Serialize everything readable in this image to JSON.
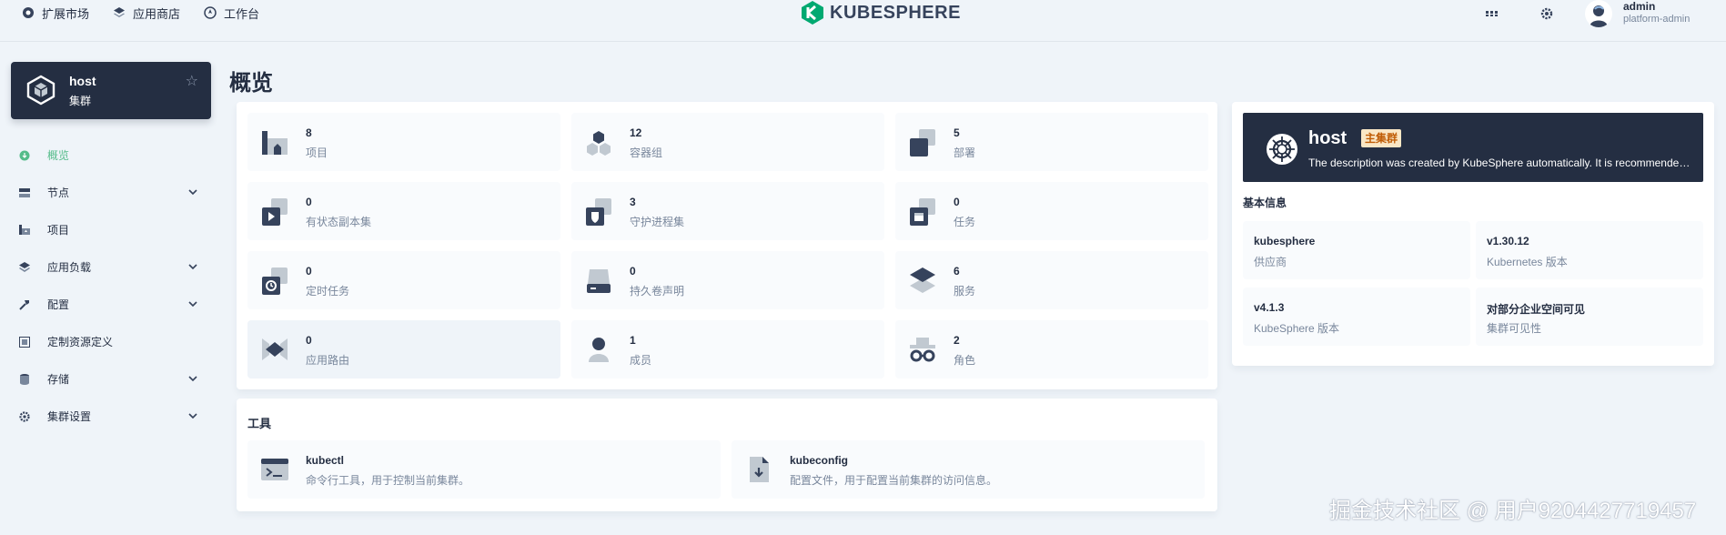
{
  "topnav": {
    "items": [
      {
        "label": "扩展市场",
        "icon": "extensions-icon"
      },
      {
        "label": "应用商店",
        "icon": "appstore-icon"
      },
      {
        "label": "工作台",
        "icon": "workbench-icon"
      }
    ]
  },
  "logo": {
    "text": "KUBESPHERE",
    "color": "#00a971"
  },
  "user": {
    "name": "admin",
    "role": "platform-admin"
  },
  "cluster": {
    "name": "host",
    "type": "集群"
  },
  "sidebar": {
    "items": [
      {
        "label": "概览",
        "icon": "overview-icon",
        "active": true
      },
      {
        "label": "节点",
        "icon": "nodes-icon",
        "expandable": true
      },
      {
        "label": "项目",
        "icon": "projects-icon"
      },
      {
        "label": "应用负载",
        "icon": "workloads-icon",
        "expandable": true
      },
      {
        "label": "配置",
        "icon": "config-icon",
        "expandable": true
      },
      {
        "label": "定制资源定义",
        "icon": "crd-icon"
      },
      {
        "label": "存储",
        "icon": "storage-icon",
        "expandable": true
      },
      {
        "label": "集群设置",
        "icon": "cluster-settings-icon",
        "expandable": true
      }
    ]
  },
  "page": {
    "title": "概览"
  },
  "resources": [
    {
      "count": "8",
      "label": "项目",
      "icon": "project-icon"
    },
    {
      "count": "12",
      "label": "容器组",
      "icon": "pod-icon"
    },
    {
      "count": "5",
      "label": "部署",
      "icon": "deployment-icon"
    },
    {
      "count": "0",
      "label": "有状态副本集",
      "icon": "statefulset-icon"
    },
    {
      "count": "3",
      "label": "守护进程集",
      "icon": "daemonset-icon"
    },
    {
      "count": "0",
      "label": "任务",
      "icon": "job-icon"
    },
    {
      "count": "0",
      "label": "定时任务",
      "icon": "cronjob-icon"
    },
    {
      "count": "0",
      "label": "持久卷声明",
      "icon": "pvc-icon"
    },
    {
      "count": "6",
      "label": "服务",
      "icon": "service-icon"
    },
    {
      "count": "0",
      "label": "应用路由",
      "icon": "ingress-icon",
      "highlighted": true
    },
    {
      "count": "1",
      "label": "成员",
      "icon": "member-icon"
    },
    {
      "count": "2",
      "label": "角色",
      "icon": "role-icon"
    }
  ],
  "tools": {
    "title": "工具",
    "items": [
      {
        "name": "kubectl",
        "desc": "命令行工具，用于控制当前集群。",
        "icon": "terminal-icon"
      },
      {
        "name": "kubeconfig",
        "desc": "配置文件，用于配置当前集群的访问信息。",
        "icon": "kubeconfig-file-icon"
      }
    ]
  },
  "cluster_info": {
    "name": "host",
    "badge": "主集群",
    "description": "The description was created by KubeSphere automatically. It is recommended that you use the Host Cluster to manage clusters only and deploy workloads on Member Clusters.",
    "section_title": "基本信息",
    "fields": [
      {
        "value": "kubesphere",
        "key": "供应商"
      },
      {
        "value": "v1.30.12",
        "key": "Kubernetes 版本"
      },
      {
        "value": "v4.1.3",
        "key": "KubeSphere 版本"
      },
      {
        "value": "对部分企业空间可见",
        "key": "集群可见性"
      }
    ]
  },
  "watermark": "掘金技术社区 @ 用户9204427719457"
}
